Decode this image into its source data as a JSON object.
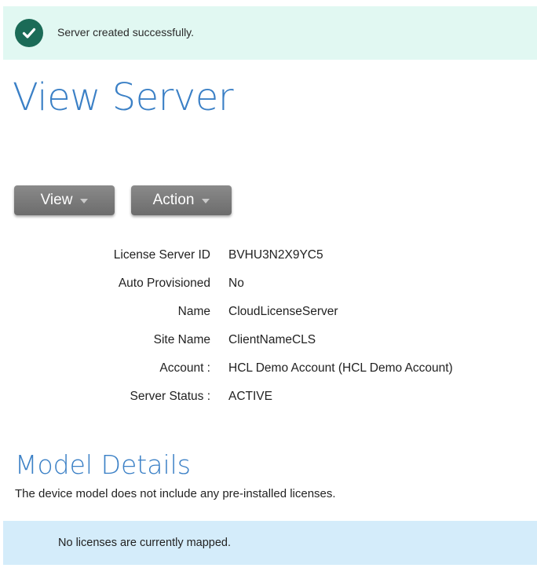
{
  "alert": {
    "icon": "check-circle-icon",
    "message": "Server created successfully.",
    "background": "#e1f8f2",
    "icon_color": "#1b6b57"
  },
  "page": {
    "title": "View Server",
    "title_color": "#3b80c6"
  },
  "toolbar": {
    "view_label": "View",
    "action_label": "Action"
  },
  "details": [
    {
      "label": "License Server ID",
      "value": "BVHU3N2X9YC5"
    },
    {
      "label": "Auto Provisioned",
      "value": "No"
    },
    {
      "label": "Name",
      "value": "CloudLicenseServer"
    },
    {
      "label": "Site Name",
      "value": "ClientNameCLS"
    },
    {
      "label": "Account :",
      "value": "HCL Demo Account (HCL Demo Account)"
    },
    {
      "label": "Server Status :",
      "value": "ACTIVE"
    }
  ],
  "model": {
    "title": "Model Details",
    "description": "The device model does not include any pre-installed licenses.",
    "notice": "No licenses are currently mapped.",
    "notice_background": "#d4ecfa"
  }
}
